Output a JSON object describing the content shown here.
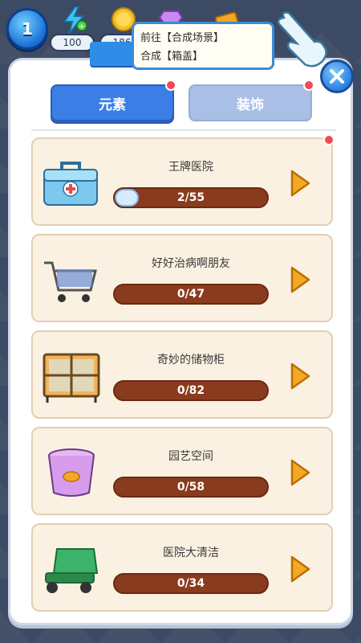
{
  "hud": {
    "level": "1",
    "energy": "100",
    "coins": "186"
  },
  "tooltip": {
    "line1": "前往【合成场景】",
    "line2": "合成【箱盖】"
  },
  "tabs": [
    {
      "label": "元素",
      "active": true
    },
    {
      "label": "装饰",
      "active": false
    }
  ],
  "items": [
    {
      "title": "王牌医院",
      "progress": "2/55",
      "fraction": 0.036,
      "icon": "medical-kit-icon"
    },
    {
      "title": "好好治病啊朋友",
      "progress": "0/47",
      "fraction": 0,
      "icon": "shopping-cart-icon"
    },
    {
      "title": "奇妙的储物柜",
      "progress": "0/82",
      "fraction": 0,
      "icon": "storage-cabinet-icon"
    },
    {
      "title": "园艺空间",
      "progress": "0/58",
      "fraction": 0,
      "icon": "flower-pot-icon"
    },
    {
      "title": "医院大清洁",
      "progress": "0/34",
      "fraction": 0,
      "icon": "floor-scrubber-icon"
    }
  ],
  "colors": {
    "tab_active": "#3b7ee6",
    "tab_inactive": "#a9bfe6",
    "bar_bg": "#8a3b1e",
    "arrow": "#f4a824",
    "card_bg": "#fbf1e2"
  }
}
